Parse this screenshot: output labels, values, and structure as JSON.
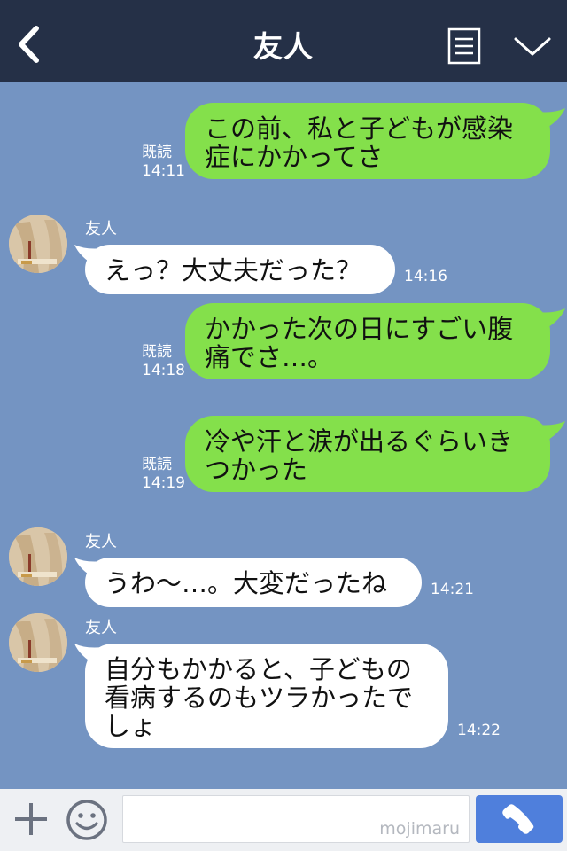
{
  "header": {
    "title": "友人"
  },
  "messages": [
    {
      "direction": "out",
      "text_line1": "この前、私と子どもが感染",
      "text_line2": "症にかかってさ",
      "read": "既読",
      "time": "14:11"
    },
    {
      "direction": "in",
      "sender": "友人",
      "text_line1": "えっ？大丈夫だった？",
      "time": "14:16"
    },
    {
      "direction": "out",
      "text_line1": "かかった次の日にすごい腹",
      "text_line2": "痛でさ…。",
      "read": "既読",
      "time": "14:18"
    },
    {
      "direction": "out",
      "text_line1": "冷や汗と涙が出るぐらいき",
      "text_line2": "つかった",
      "read": "既読",
      "time": "14:19"
    },
    {
      "direction": "in",
      "sender": "友人",
      "text_line1": "うわ〜…。大変だったね",
      "time": "14:21"
    },
    {
      "direction": "in",
      "sender": "友人",
      "text_line1": "自分もかかると、子どもの",
      "text_line2": "看病するのもツラかったで",
      "text_line3": "しょ",
      "time": "14:22"
    }
  ],
  "footer": {
    "input_value": "",
    "watermark": "mojimaru"
  },
  "colors": {
    "header_bg": "#253047",
    "chat_bg": "#7494c2",
    "outgoing_bubble": "#84e04b",
    "incoming_bubble": "#ffffff",
    "call_button": "#4f7fdc"
  },
  "icons": [
    "back-chevron-icon",
    "menu-list-icon",
    "chevron-down-icon",
    "plus-icon",
    "smiley-icon",
    "phone-icon"
  ]
}
